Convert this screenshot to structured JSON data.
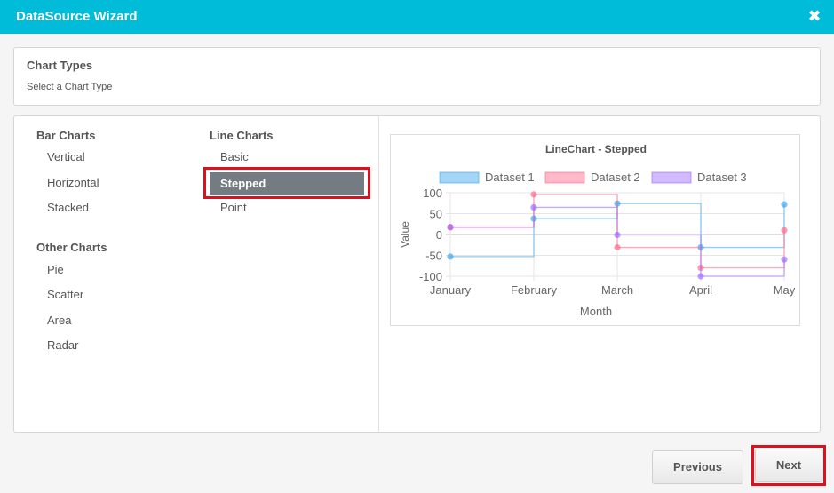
{
  "window": {
    "title": "DataSource Wizard",
    "close_icon": "close-icon"
  },
  "chart_types": {
    "heading": "Chart Types",
    "subheading": "Select a Chart Type"
  },
  "groups": {
    "bar": {
      "title": "Bar Charts",
      "items": [
        "Vertical",
        "Horizontal",
        "Stacked"
      ]
    },
    "other": {
      "title": "Other Charts",
      "items": [
        "Pie",
        "Scatter",
        "Area",
        "Radar"
      ]
    },
    "line": {
      "title": "Line Charts",
      "items": [
        "Basic",
        "Stepped",
        "Point"
      ],
      "selected": "Stepped"
    }
  },
  "buttons": {
    "previous": "Previous",
    "next": "Next"
  },
  "colors": {
    "accent": "#00bcd8",
    "selected": "#757b83",
    "highlight": "#e00f1c"
  },
  "chart_data": {
    "type": "line",
    "step": true,
    "title": "LineChart - Stepped",
    "xlabel": "Month",
    "ylabel": "Value",
    "categories": [
      "January",
      "February",
      "March",
      "April",
      "May"
    ],
    "ylim": [
      -100,
      100
    ],
    "yticks": [
      100,
      50,
      0,
      -50,
      -100
    ],
    "legend": "top",
    "series": [
      {
        "name": "Dataset 1",
        "values": [
          -53,
          38,
          74,
          -31,
          72
        ],
        "color": "#36a2eb"
      },
      {
        "name": "Dataset 2",
        "values": [
          17,
          96,
          -31,
          -80,
          10
        ],
        "color": "#ff6384"
      },
      {
        "name": "Dataset 3",
        "values": [
          18,
          65,
          -1,
          -100,
          -60
        ],
        "color": "#9966ff"
      }
    ]
  }
}
